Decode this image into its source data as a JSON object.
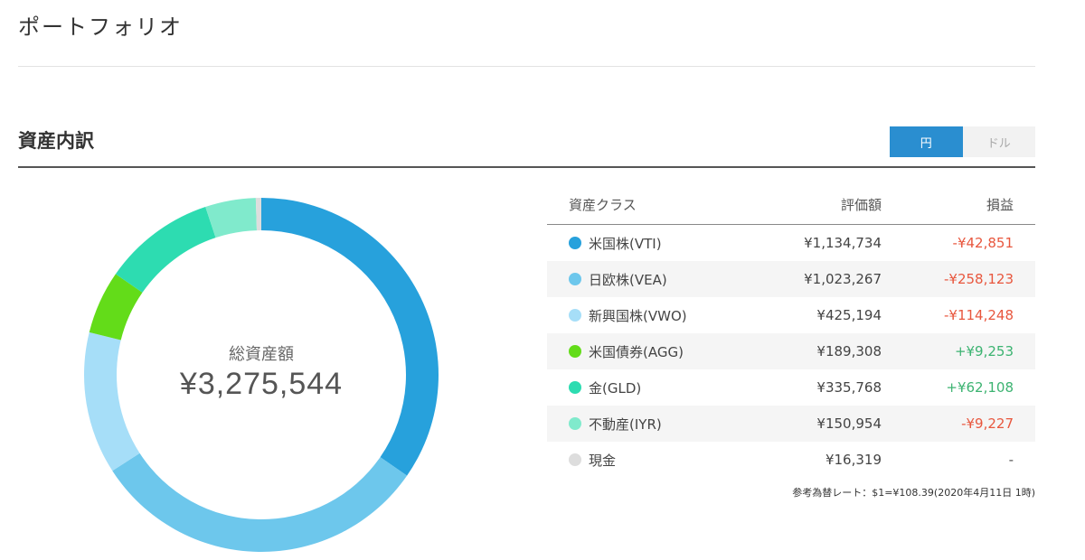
{
  "header": {
    "title": "ポートフォリオ"
  },
  "section": {
    "title": "資産内訳"
  },
  "currency_toggle": {
    "yen_label": "円",
    "dollar_label": "ドル",
    "selected": "円"
  },
  "summary": {
    "label": "総資産額",
    "value": "¥3,275,544"
  },
  "table": {
    "headers": {
      "asset_class": "資産クラス",
      "valuation": "評価額",
      "profit_loss": "損益"
    },
    "rows": [
      {
        "name": "米国株(VTI)",
        "value": "¥1,134,734",
        "pl": "-¥42,851",
        "color": "#27a1dc",
        "amount": 1134734
      },
      {
        "name": "日欧株(VEA)",
        "value": "¥1,023,267",
        "pl": "-¥258,123",
        "color": "#6dc7ec",
        "amount": 1023267
      },
      {
        "name": "新興国株(VWO)",
        "value": "¥425,194",
        "pl": "-¥114,248",
        "color": "#a6def8",
        "amount": 425194
      },
      {
        "name": "米国債券(AGG)",
        "value": "¥189,308",
        "pl": "+¥9,253",
        "color": "#63dc19",
        "amount": 189308
      },
      {
        "name": "金(GLD)",
        "value": "¥335,768",
        "pl": "+¥62,108",
        "color": "#2ddcb1",
        "amount": 335768
      },
      {
        "name": "不動産(IYR)",
        "value": "¥150,954",
        "pl": "-¥9,227",
        "color": "#80eacc",
        "amount": 150954
      },
      {
        "name": "現金",
        "value": "¥16,319",
        "pl": "-",
        "color": "#dddddd",
        "amount": 16319
      }
    ]
  },
  "note": "参考為替レート：$1=¥108.39(2020年4月11日 1時)"
}
